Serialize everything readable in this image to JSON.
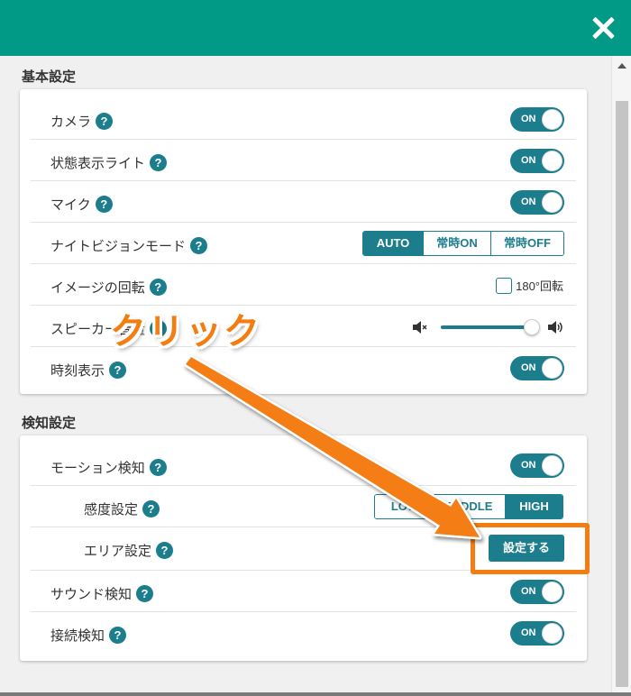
{
  "header": {
    "close_label": "✕"
  },
  "sections": {
    "basic": {
      "title": "基本設定",
      "camera": {
        "label": "カメラ",
        "toggle": "ON"
      },
      "status_light": {
        "label": "状態表示ライト",
        "toggle": "ON"
      },
      "mic": {
        "label": "マイク",
        "toggle": "ON"
      },
      "night_vision": {
        "label": "ナイトビジョンモード",
        "options": [
          "AUTO",
          "常時ON",
          "常時OFF"
        ],
        "selected": "AUTO"
      },
      "rotation": {
        "label": "イメージの回転",
        "checkbox_label": "180°回転",
        "checked": false
      },
      "speaker": {
        "label": "スピーカー音量",
        "volume_percent": 95
      },
      "time_display": {
        "label": "時刻表示",
        "toggle": "ON"
      }
    },
    "detection": {
      "title": "検知設定",
      "motion": {
        "label": "モーション検知",
        "toggle": "ON"
      },
      "sensitivity": {
        "label": "感度設定",
        "options": [
          "LOW",
          "MIDDLE",
          "HIGH"
        ],
        "selected": "HIGH"
      },
      "area": {
        "label": "エリア設定",
        "button_label": "設定する"
      },
      "sound": {
        "label": "サウンド検知",
        "toggle": "ON"
      },
      "connection": {
        "label": "接続検知",
        "toggle": "ON"
      }
    }
  },
  "help_glyph": "?",
  "annotation": {
    "text": "クリック",
    "color": "#f47d12"
  },
  "colors": {
    "header": "#009a86",
    "accent": "#1c7d8c",
    "annotation": "#f47d12"
  }
}
